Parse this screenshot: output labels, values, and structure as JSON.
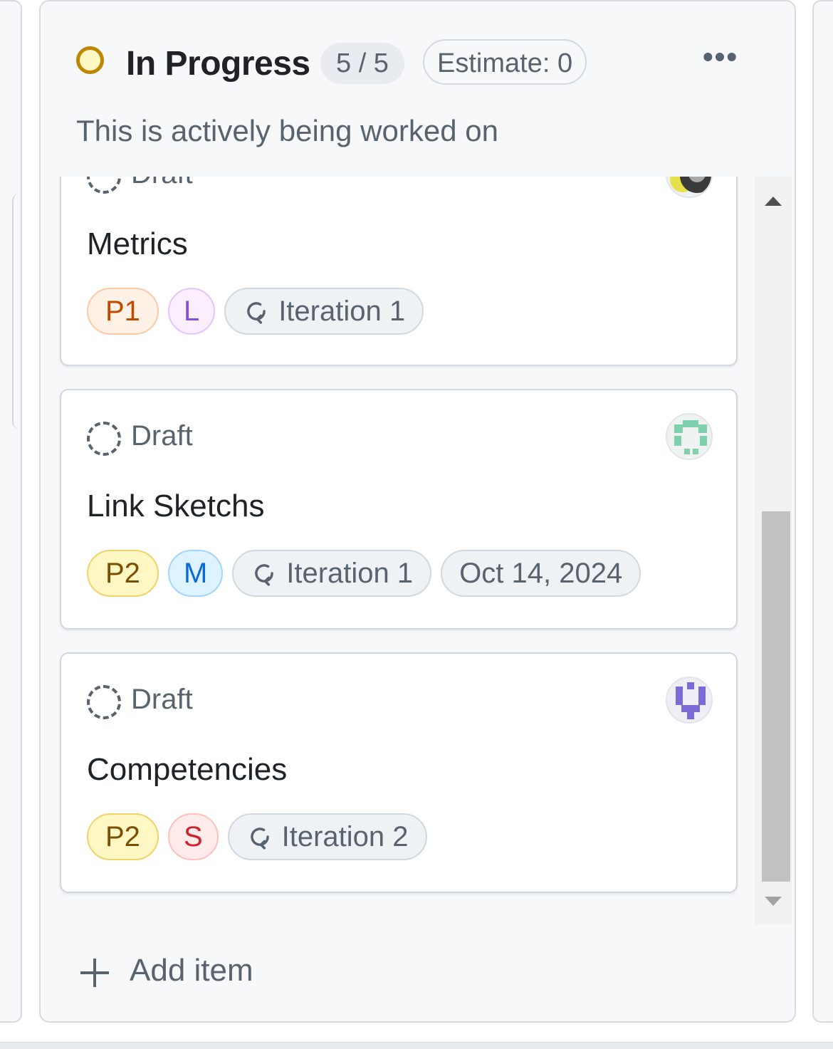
{
  "column": {
    "title": "In Progress",
    "count": "5 / 5",
    "estimate": "Estimate: 0",
    "description": "This is actively being worked on",
    "status_color": "#bf8700",
    "add_item_label": "Add item"
  },
  "cards": [
    {
      "status": "Draft",
      "title": "Metrics",
      "priority": "P1",
      "size": "L",
      "iteration": "Iteration 1",
      "date": "",
      "avatar": "identicon-grey"
    },
    {
      "status": "Draft",
      "title": "Link Sketchs",
      "priority": "P2",
      "size": "M",
      "iteration": "Iteration 1",
      "date": "Oct 14, 2024",
      "avatar": "identicon-green"
    },
    {
      "status": "Draft",
      "title": "Competencies",
      "priority": "P2",
      "size": "S",
      "iteration": "Iteration 2",
      "date": "",
      "avatar": "identicon-purple"
    }
  ]
}
